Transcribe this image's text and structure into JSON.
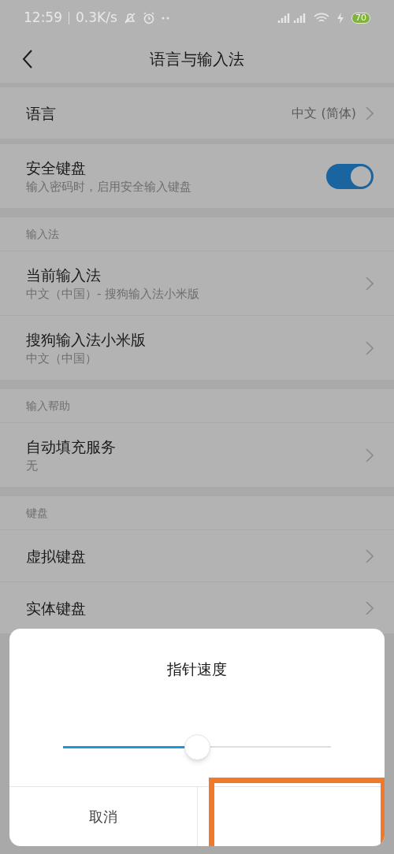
{
  "status_bar": {
    "time": "12:59",
    "speed": "0.3K/s",
    "battery": "70"
  },
  "header": {
    "title": "语言与输入法"
  },
  "sections": [
    {
      "items": [
        {
          "kind": "value",
          "title": "语言",
          "value": "中文 (简体)"
        }
      ]
    },
    {
      "items": [
        {
          "kind": "switch",
          "title": "安全键盘",
          "subtitle": "输入密码时，启用安全输入键盘",
          "on": true
        }
      ]
    },
    {
      "heading": "输入法",
      "items": [
        {
          "kind": "link",
          "title": "当前输入法",
          "subtitle": "中文（中国）- 搜狗输入法小米版"
        },
        {
          "kind": "link",
          "title": "搜狗输入法小米版",
          "subtitle": "中文（中国）"
        }
      ]
    },
    {
      "heading": "输入帮助",
      "items": [
        {
          "kind": "link",
          "title": "自动填充服务",
          "subtitle": "无"
        }
      ]
    },
    {
      "heading": "键盘",
      "items": [
        {
          "kind": "link",
          "title": "虚拟键盘"
        },
        {
          "kind": "link",
          "title": "实体键盘"
        }
      ]
    }
  ],
  "dialog": {
    "title": "指针速度",
    "slider": {
      "level": 0.5
    },
    "buttons": [
      {
        "label": "取消",
        "highlighted": false
      },
      {
        "highlighted": true
      }
    ]
  }
}
